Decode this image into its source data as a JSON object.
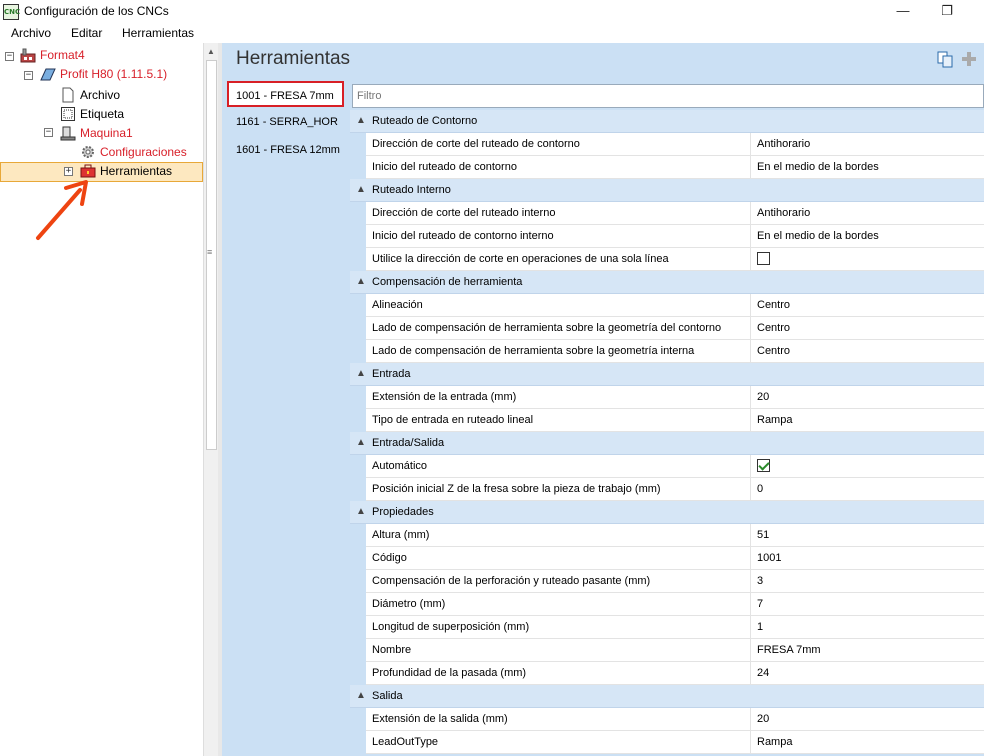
{
  "window": {
    "title": "Configuración de los CNCs",
    "app_icon_text": "CNC"
  },
  "menu": [
    "Archivo",
    "Editar",
    "Herramientas"
  ],
  "tree": {
    "root": "Format4",
    "machine": "Profit H80 (1.11.5.1)",
    "archivo": "Archivo",
    "etiqueta": "Etiqueta",
    "maquina": "Maquina1",
    "configuraciones": "Configuraciones",
    "herramientas": "Herramientas"
  },
  "header": {
    "title": "Herramientas",
    "copy_icon": "copy-icon",
    "add_icon": "add-icon"
  },
  "tools": [
    {
      "label": "1001 - FRESA 7mm",
      "selected": true
    },
    {
      "label": "1161 - SERRA_HOR",
      "selected": false
    },
    {
      "label": "1601 - FRESA 12mm",
      "selected": false
    }
  ],
  "filter": {
    "placeholder": "Filtro"
  },
  "categories": [
    {
      "name": "Ruteado de Contorno",
      "rows": [
        {
          "name": "Dirección de corte del ruteado de contorno",
          "value": "Antihorario"
        },
        {
          "name": "Inicio del ruteado de contorno",
          "value": "En el medio de la bordes"
        }
      ]
    },
    {
      "name": "Ruteado Interno",
      "rows": [
        {
          "name": "Dirección de corte del ruteado interno",
          "value": "Antihorario"
        },
        {
          "name": "Inicio del ruteado de contorno interno",
          "value": "En el medio de la bordes"
        },
        {
          "name": "Utilice la dirección de corte en operaciones de una sola línea",
          "value": "",
          "checkbox": false
        }
      ]
    },
    {
      "name": "Compensación de herramienta",
      "rows": [
        {
          "name": "Alineación",
          "value": "Centro"
        },
        {
          "name": "Lado de compensación de herramienta sobre la geometría del contorno",
          "value": "Centro"
        },
        {
          "name": "Lado de compensación de herramienta sobre la geometría interna",
          "value": "Centro"
        }
      ]
    },
    {
      "name": "Entrada",
      "rows": [
        {
          "name": "Extensión de la entrada (mm)",
          "value": "20"
        },
        {
          "name": "Tipo de entrada en ruteado lineal",
          "value": "Rampa"
        }
      ]
    },
    {
      "name": "Entrada/Salida",
      "rows": [
        {
          "name": "Automático",
          "value": "",
          "checkbox": true
        },
        {
          "name": "Posición inicial Z de la fresa sobre la pieza de trabajo (mm)",
          "value": "0"
        }
      ]
    },
    {
      "name": "Propiedades",
      "rows": [
        {
          "name": "Altura (mm)",
          "value": "51"
        },
        {
          "name": "Código",
          "value": "1001"
        },
        {
          "name": "Compensación de la perforación y ruteado pasante (mm)",
          "value": "3"
        },
        {
          "name": "Diámetro (mm)",
          "value": "7"
        },
        {
          "name": "Longitud de superposición (mm)",
          "value": "1"
        },
        {
          "name": "Nombre",
          "value": "FRESA 7mm"
        },
        {
          "name": "Profundidad de la pasada (mm)",
          "value": "24"
        }
      ]
    },
    {
      "name": "Salida",
      "rows": [
        {
          "name": "Extensión de la salida (mm)",
          "value": "20"
        },
        {
          "name": "LeadOutType",
          "value": "Rampa"
        }
      ]
    }
  ],
  "colors": {
    "accent_red": "#d81f26",
    "panel_blue": "#cbe0f4",
    "selection": "#fde8c0"
  }
}
